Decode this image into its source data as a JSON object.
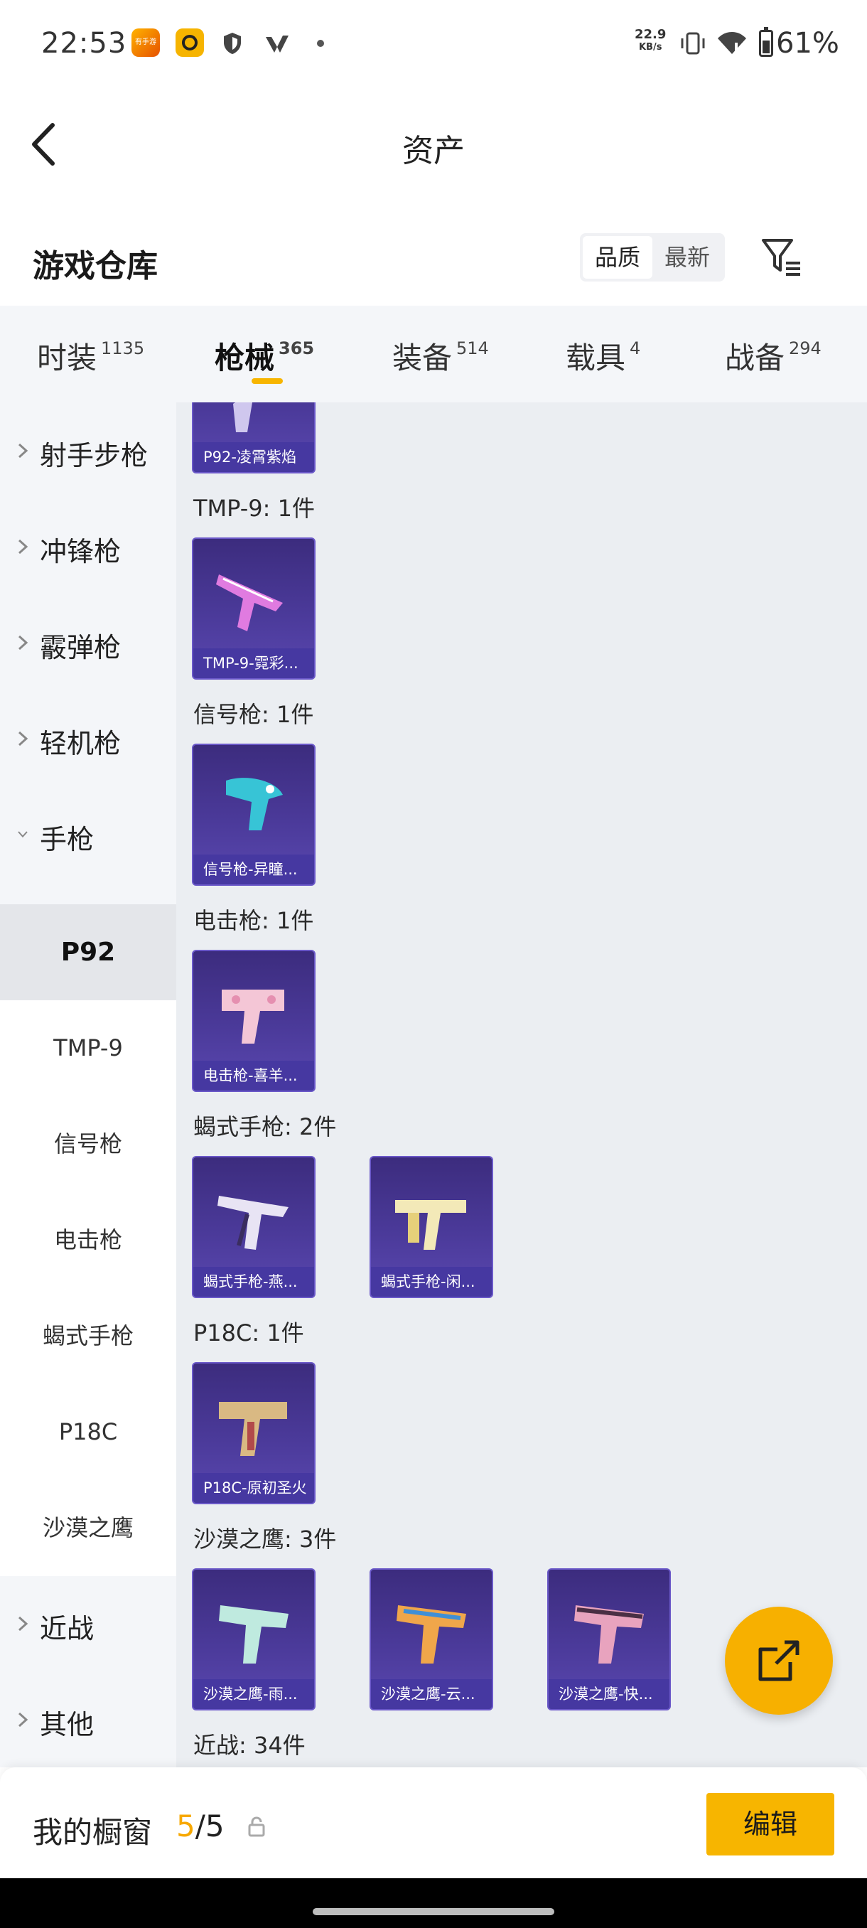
{
  "status_bar": {
    "time": "22:53",
    "speed_value": "22.9",
    "speed_unit": "KB/s",
    "battery": "61%",
    "app1_text": "有手游"
  },
  "header": {
    "title": "资产",
    "back_icon": "chevron-left-icon"
  },
  "section": {
    "title": "游戏仓库",
    "sort_quality": "品质",
    "sort_newest": "最新",
    "filter_icon": "filter-icon"
  },
  "tabs": [
    {
      "label": "时装",
      "count": "1135"
    },
    {
      "label": "枪械",
      "count": "365"
    },
    {
      "label": "装备",
      "count": "514"
    },
    {
      "label": "载具",
      "count": "4"
    },
    {
      "label": "战备",
      "count": "294"
    }
  ],
  "sidebar": {
    "categories": [
      {
        "label": "射手步枪"
      },
      {
        "label": "冲锋枪"
      },
      {
        "label": "霰弹枪"
      },
      {
        "label": "轻机枪"
      },
      {
        "label": "手枪"
      }
    ],
    "subs": [
      {
        "label": "P92"
      },
      {
        "label": "TMP-9"
      },
      {
        "label": "信号枪"
      },
      {
        "label": "电击枪"
      },
      {
        "label": "蝎式手枪"
      },
      {
        "label": "P18C"
      },
      {
        "label": "沙漠之鹰"
      }
    ],
    "bottom_categories": [
      {
        "label": "近战"
      },
      {
        "label": "其他"
      }
    ]
  },
  "content": {
    "top_card": "P92-凌霄紫焰",
    "groups": [
      {
        "label": "TMP-9: 1件",
        "items": [
          "TMP-9-霓彩..."
        ]
      },
      {
        "label": "信号枪: 1件",
        "items": [
          "信号枪-异瞳..."
        ]
      },
      {
        "label": "电击枪: 1件",
        "items": [
          "电击枪-喜羊..."
        ]
      },
      {
        "label": "蝎式手枪: 2件",
        "items": [
          "蝎式手枪-燕...",
          "蝎式手枪-闲..."
        ]
      },
      {
        "label": "P18C: 1件",
        "items": [
          "P18C-原初圣火"
        ]
      },
      {
        "label": "沙漠之鹰: 3件",
        "items": [
          "沙漠之鹰-雨...",
          "沙漠之鹰-云...",
          "沙漠之鹰-快..."
        ]
      },
      {
        "label": "近战: 34件",
        "items": []
      }
    ]
  },
  "bottom": {
    "showcase_label": "我的橱窗",
    "showcase_used": "5",
    "showcase_sep": "/",
    "showcase_total": "5",
    "edit_label": "编辑"
  },
  "colors": {
    "accent": "#f7b500",
    "card_bg": "#4b3a9a",
    "content_bg": "#ebeef2",
    "sidebar_bg": "#f4f6f9"
  }
}
